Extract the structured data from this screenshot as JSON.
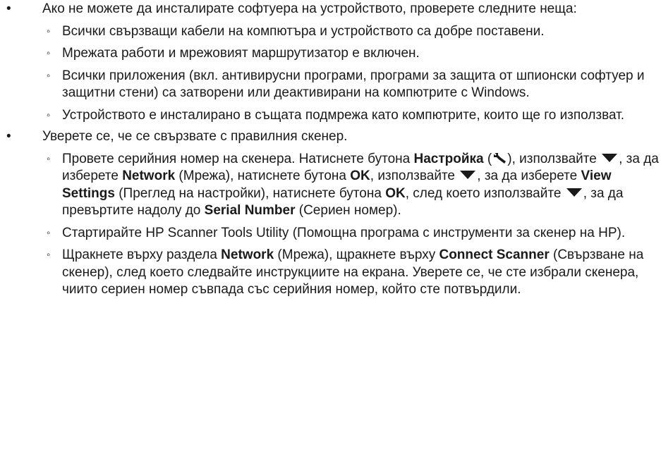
{
  "bullets": {
    "l1": "•",
    "l2": "◦"
  },
  "section1": {
    "intro": "Ако не можете да инсталирате софтуера на устройството, проверете следните неща:",
    "items": [
      "Всички свързващи кабели на компютъра и устройството са добре поставени.",
      "Мрежата работи и мрежовият маршрутизатор е включен.",
      "Всички приложения (вкл. антивирусни програми, програми за защита от шпионски софтуер и защитни стени) са затворени или деактивирани на компютрите с Windows.",
      "Устройството е инсталирано в същата подмрежа като компютрите, които ще го използват."
    ]
  },
  "section2": {
    "intro": "Уверете се, че се свързвате с правилния скенер.",
    "step1": {
      "t1": "Провете серийния номер на скенера. Натиснете бутона ",
      "b1": "Настройка",
      "t2": " (",
      "icon1": "wrench-icon",
      "t3": "), използвайте ",
      "icon2": "down-arrow-icon",
      "t4": ", за да изберете ",
      "b2": "Network",
      "t5": " (Мрежа), натиснете бутона ",
      "b3": "OK",
      "t6": ", използвайте ",
      "t7": ", за да изберете ",
      "b4": "View Settings",
      "t8": " (Преглед на настройки), натиснете бутона ",
      "b5": "OK",
      "t9": ", след което използвайте ",
      "t10": ", за да превъртите надолу до ",
      "b6": "Serial Number",
      "t11": " (Сериен номер)."
    },
    "step2": "Стартирайте HP Scanner Tools Utility (Помощна програма с инструменти за скенер на HP).",
    "step3": {
      "t1": "Щракнете върху раздела ",
      "b1": "Network",
      "t2": " (Мрежа), щракнете върху  ",
      "b2": "Connect Scanner",
      "t3": " (Свързване на скенер), след което следвайте инструкциите на екрана. Уверете се, че сте избрали скенера, чиито сериен номер съвпада със серийния номер, който сте потвърдили."
    }
  }
}
